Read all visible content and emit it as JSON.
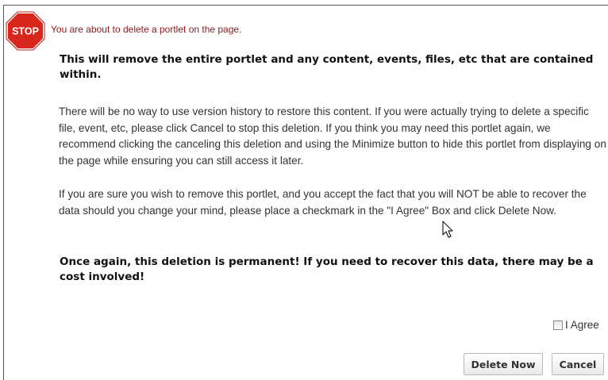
{
  "dialog": {
    "stop_sign_text": "STOP",
    "title": "You are about to delete a portlet on the page.",
    "bold_warning_1": "This will remove the entire portlet and any content, events, files, etc that are contained within.",
    "paragraph_1": "There will be no way to use version history to restore this content. If you were actually trying to delete a specific file, event, etc, please click Cancel to stop this deletion. If you think you may need this portlet again, we recommend clicking the canceling this deletion and using the Minimize button to hide this portlet from displaying on the page while ensuring you can still access it later.",
    "paragraph_2": "If you are sure you wish to remove this portlet, and you accept the fact that you will NOT be able to recover the data should you change your mind, please place a checkmark in the \"I Agree\" Box and click Delete Now.",
    "bold_warning_2": "Once again, this deletion is permanent! If you need to recover this data, there may be a cost involved!",
    "agree_label": "I Agree",
    "agree_checked": false,
    "delete_button": "Delete Now",
    "cancel_button": "Cancel"
  },
  "colors": {
    "stop_red": "#d9261c",
    "title_color": "#8b1a1a"
  },
  "icons": {
    "stop": "stop-sign-icon",
    "cursor": "mouse-pointer-icon"
  }
}
